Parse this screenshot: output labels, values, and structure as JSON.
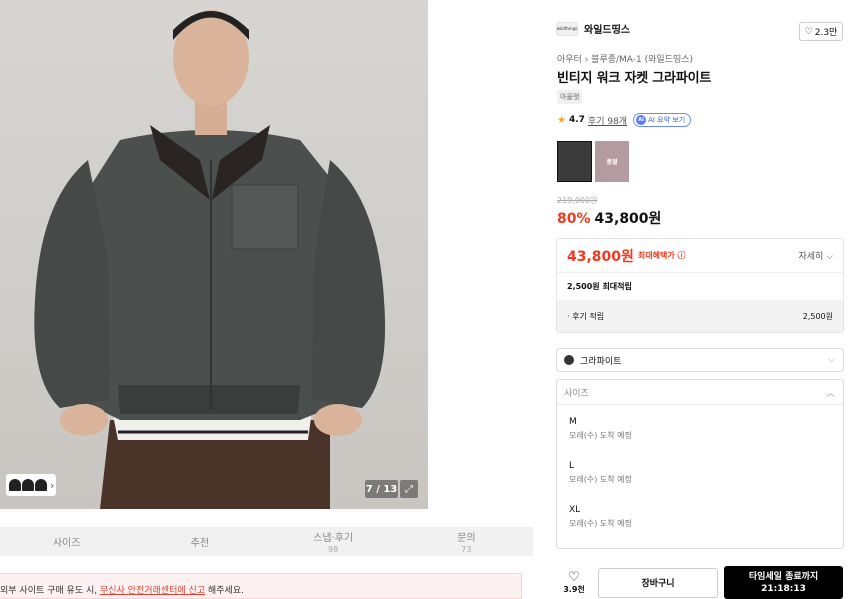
{
  "gallery": {
    "counter": "7 / 13",
    "thumb_chevron": "›",
    "expand_icon": "⤢"
  },
  "tabs": [
    {
      "label": "사이즈",
      "sub": ""
    },
    {
      "label": "추천",
      "sub": ""
    },
    {
      "label": "스냅·후기",
      "sub": "98"
    },
    {
      "label": "문의",
      "sub": "73"
    }
  ],
  "notice": {
    "prefix": "외부 사이트 구매 유도 시, ",
    "link": "무신사 안전거래센터에 신고",
    "suffix": " 해주세요."
  },
  "product": {
    "brand_logo": "wildthings",
    "brand": "와일드띵스",
    "likes": "2.3만",
    "breadcrumb": "아우터 › 블루종/MA-1 (와일드띵스)",
    "title": "빈티지 워크 자켓 그라파이트",
    "tag": "아울렛",
    "rating": "4.7",
    "review_link": "후기 98개",
    "ai_label": "AI 요약 보기",
    "ai_badge": "AI",
    "sold_out_label": "품절",
    "original_price": "219,000원",
    "discount": "80%",
    "sale_price": "43,800원"
  },
  "benefit": {
    "price": "43,800원",
    "label": "최대혜택가 ⓘ",
    "more": "자세히 ⌵",
    "max_points": "2,500원 최대적립",
    "review_points_label": "· 후기 적립",
    "review_points_value": "2,500원"
  },
  "options": {
    "color": "그라파이트",
    "size_header": "사이즈",
    "sizes": [
      {
        "size": "M",
        "eta": "모레(수) 도착 예정"
      },
      {
        "size": "L",
        "eta": "모레(수) 도착 예정"
      },
      {
        "size": "XL",
        "eta": "모레(수) 도착 예정"
      }
    ]
  },
  "actions": {
    "like_count": "3.9천",
    "cart": "장바구니",
    "buy_line1": "타임세일 종료까지",
    "buy_line2": "21:18:13"
  }
}
